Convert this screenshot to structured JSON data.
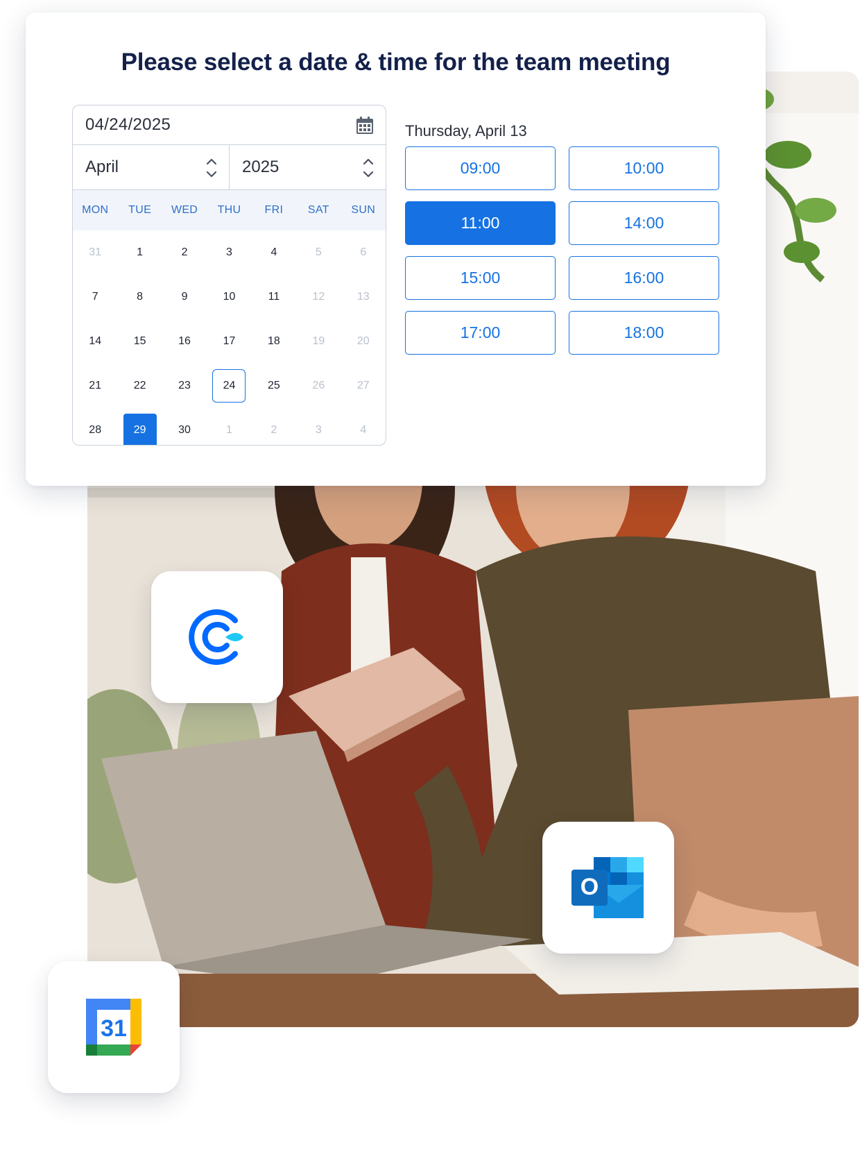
{
  "card": {
    "title": "Please select a date & time for the team meeting"
  },
  "date_picker": {
    "date_value": "04/24/2025",
    "month": "April",
    "year": "2025",
    "weekdays": [
      "MON",
      "TUE",
      "WED",
      "THU",
      "FRI",
      "SAT",
      "SUN"
    ],
    "days": [
      {
        "label": "31",
        "state": "muted"
      },
      {
        "label": "1",
        "state": "normal"
      },
      {
        "label": "2",
        "state": "normal"
      },
      {
        "label": "3",
        "state": "normal"
      },
      {
        "label": "4",
        "state": "normal"
      },
      {
        "label": "5",
        "state": "muted"
      },
      {
        "label": "6",
        "state": "muted"
      },
      {
        "label": "7",
        "state": "normal"
      },
      {
        "label": "8",
        "state": "normal"
      },
      {
        "label": "9",
        "state": "normal"
      },
      {
        "label": "10",
        "state": "normal"
      },
      {
        "label": "11",
        "state": "normal"
      },
      {
        "label": "12",
        "state": "muted"
      },
      {
        "label": "13",
        "state": "muted"
      },
      {
        "label": "14",
        "state": "normal"
      },
      {
        "label": "15",
        "state": "normal"
      },
      {
        "label": "16",
        "state": "normal"
      },
      {
        "label": "17",
        "state": "normal"
      },
      {
        "label": "18",
        "state": "normal"
      },
      {
        "label": "19",
        "state": "muted"
      },
      {
        "label": "20",
        "state": "muted"
      },
      {
        "label": "21",
        "state": "normal"
      },
      {
        "label": "22",
        "state": "normal"
      },
      {
        "label": "23",
        "state": "normal"
      },
      {
        "label": "24",
        "state": "today"
      },
      {
        "label": "25",
        "state": "normal"
      },
      {
        "label": "26",
        "state": "muted"
      },
      {
        "label": "27",
        "state": "muted"
      },
      {
        "label": "28",
        "state": "normal"
      },
      {
        "label": "29",
        "state": "selected"
      },
      {
        "label": "30",
        "state": "normal"
      },
      {
        "label": "1",
        "state": "muted"
      },
      {
        "label": "2",
        "state": "muted"
      },
      {
        "label": "3",
        "state": "muted"
      },
      {
        "label": "4",
        "state": "muted"
      }
    ]
  },
  "time_slots": {
    "heading": "Thursday, April 13",
    "slots": [
      {
        "label": "09:00",
        "active": false
      },
      {
        "label": "10:00",
        "active": false
      },
      {
        "label": "11:00",
        "active": true
      },
      {
        "label": "14:00",
        "active": false
      },
      {
        "label": "15:00",
        "active": false
      },
      {
        "label": "16:00",
        "active": false
      },
      {
        "label": "17:00",
        "active": false
      },
      {
        "label": "18:00",
        "active": false
      }
    ]
  },
  "integrations": {
    "google_calendar_number": "31",
    "outlook_letter": "O"
  },
  "colors": {
    "accent": "#1672e2",
    "title": "#13204a",
    "weekday_text": "#2f6fc7",
    "weekday_bg": "#f1f5fb",
    "border": "#c9d1dc",
    "muted_day": "#b9c0cc"
  },
  "icons": {
    "date_field": "calendar-icon",
    "month_stepper": "chevron-up-down-icon",
    "year_stepper": "chevron-up-down-icon",
    "calendly": "calendly-logo-icon",
    "outlook": "outlook-logo-icon",
    "google_calendar": "google-calendar-logo-icon"
  }
}
